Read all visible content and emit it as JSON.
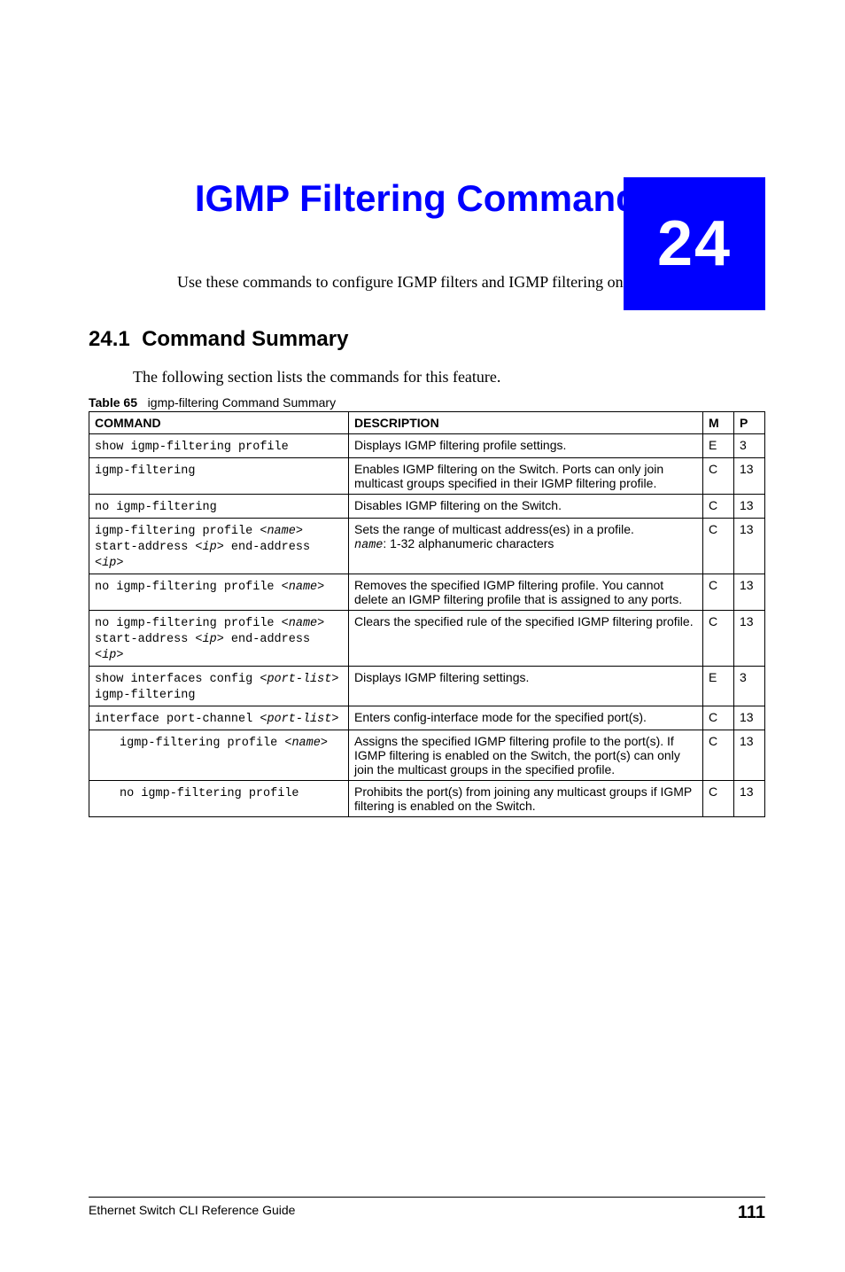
{
  "chapter_number": "24",
  "chapter_title": "IGMP Filtering Commands",
  "intro": "Use these commands to configure IGMP filters and IGMP filtering on the Switch.",
  "section": {
    "number": "24.1",
    "title": "Command Summary",
    "text": "The following section lists the commands for this feature."
  },
  "table": {
    "label": "Table 65",
    "caption": "igmp-filtering Command Summary",
    "headers": {
      "cmd": "COMMAND",
      "desc": "DESCRIPTION",
      "m": "M",
      "p": "P"
    },
    "rows": [
      {
        "cmd_parts": [
          {
            "t": "show igmp-filtering profile",
            "style": "mono"
          }
        ],
        "indent": false,
        "desc_parts": [
          {
            "t": "Displays IGMP filtering profile settings.",
            "style": "plain"
          }
        ],
        "m": "E",
        "p": "3"
      },
      {
        "cmd_parts": [
          {
            "t": "igmp-filtering",
            "style": "mono"
          }
        ],
        "indent": false,
        "desc_parts": [
          {
            "t": "Enables IGMP filtering on the Switch. Ports can only join multicast groups specified in their IGMP filtering profile.",
            "style": "plain"
          }
        ],
        "m": "C",
        "p": "13"
      },
      {
        "cmd_parts": [
          {
            "t": "no igmp-filtering",
            "style": "mono"
          }
        ],
        "indent": false,
        "desc_parts": [
          {
            "t": "Disables IGMP filtering on the Switch.",
            "style": "plain"
          }
        ],
        "m": "C",
        "p": "13"
      },
      {
        "cmd_parts": [
          {
            "t": "igmp-filtering profile <",
            "style": "mono"
          },
          {
            "t": "name",
            "style": "mono-i"
          },
          {
            "t": "> start-address <",
            "style": "mono"
          },
          {
            "t": "ip",
            "style": "mono-i"
          },
          {
            "t": "> end-address <",
            "style": "mono"
          },
          {
            "t": "ip",
            "style": "mono-i"
          },
          {
            "t": ">",
            "style": "mono"
          }
        ],
        "indent": false,
        "desc_parts": [
          {
            "t": "Sets the range of multicast address(es) in a profile.",
            "style": "plain"
          },
          {
            "t": "\n",
            "style": "br"
          },
          {
            "t": "name",
            "style": "mono-i"
          },
          {
            "t": ": 1-32 alphanumeric characters",
            "style": "plain"
          }
        ],
        "m": "C",
        "p": "13"
      },
      {
        "cmd_parts": [
          {
            "t": "no igmp-filtering profile <",
            "style": "mono"
          },
          {
            "t": "name",
            "style": "mono-i"
          },
          {
            "t": ">",
            "style": "mono"
          }
        ],
        "indent": false,
        "desc_parts": [
          {
            "t": "Removes the specified IGMP filtering profile. You cannot delete an IGMP filtering profile that is assigned to any ports.",
            "style": "plain"
          }
        ],
        "m": "C",
        "p": "13"
      },
      {
        "cmd_parts": [
          {
            "t": "no igmp-filtering profile <",
            "style": "mono"
          },
          {
            "t": "name",
            "style": "mono-i"
          },
          {
            "t": "> start-address <",
            "style": "mono"
          },
          {
            "t": "ip",
            "style": "mono-i"
          },
          {
            "t": "> end-address <",
            "style": "mono"
          },
          {
            "t": "ip",
            "style": "mono-i"
          },
          {
            "t": ">",
            "style": "mono"
          }
        ],
        "indent": false,
        "desc_parts": [
          {
            "t": "Clears the specified rule of the specified IGMP filtering profile.",
            "style": "plain"
          }
        ],
        "m": "C",
        "p": "13"
      },
      {
        "cmd_parts": [
          {
            "t": "show interfaces config <",
            "style": "mono"
          },
          {
            "t": "port-list",
            "style": "mono-i"
          },
          {
            "t": "> igmp-filtering",
            "style": "mono"
          }
        ],
        "indent": false,
        "desc_parts": [
          {
            "t": "Displays IGMP filtering settings.",
            "style": "plain"
          }
        ],
        "m": "E",
        "p": "3"
      },
      {
        "cmd_parts": [
          {
            "t": "interface port-channel <",
            "style": "mono"
          },
          {
            "t": "port-list",
            "style": "mono-i"
          },
          {
            "t": ">",
            "style": "mono"
          }
        ],
        "indent": false,
        "desc_parts": [
          {
            "t": "Enters config-interface mode for the specified port(s).",
            "style": "plain"
          }
        ],
        "m": "C",
        "p": "13"
      },
      {
        "cmd_parts": [
          {
            "t": "igmp-filtering profile <",
            "style": "mono"
          },
          {
            "t": "name",
            "style": "mono-i"
          },
          {
            "t": ">",
            "style": "mono"
          }
        ],
        "indent": true,
        "desc_parts": [
          {
            "t": "Assigns the specified IGMP filtering profile to the port(s). If IGMP filtering is enabled on the Switch, the port(s) can only join the multicast groups in the specified profile.",
            "style": "plain"
          }
        ],
        "m": "C",
        "p": "13"
      },
      {
        "cmd_parts": [
          {
            "t": "no igmp-filtering profile",
            "style": "mono"
          }
        ],
        "indent": true,
        "desc_parts": [
          {
            "t": "Prohibits the port(s) from joining any multicast groups if IGMP filtering is enabled on the Switch.",
            "style": "plain"
          }
        ],
        "m": "C",
        "p": "13"
      }
    ]
  },
  "footer": {
    "left": "Ethernet Switch CLI Reference Guide",
    "page": "111"
  }
}
